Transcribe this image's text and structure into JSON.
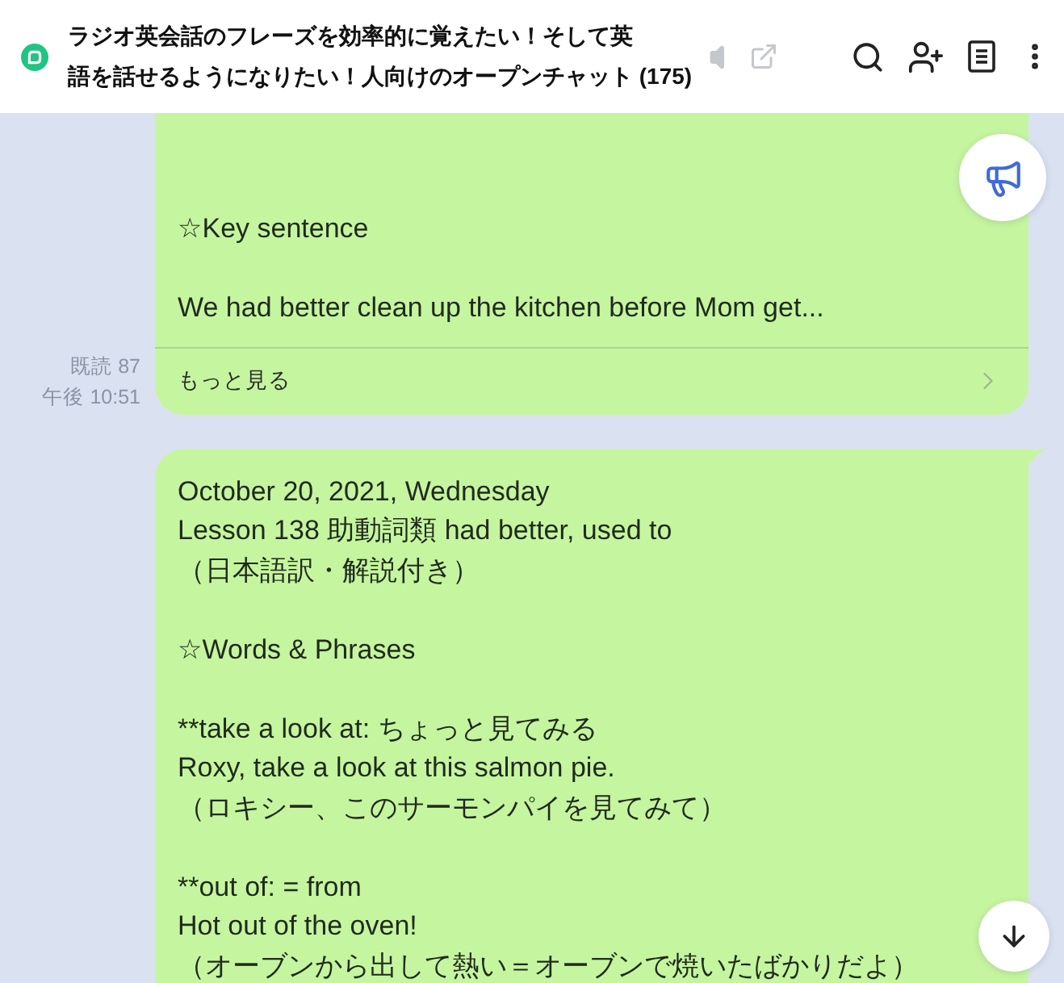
{
  "header": {
    "title_lines": [
      "ラジオ英会話のフレーズを効率的に覚えたい！そして英",
      "語を話せるようになりたい！人向けのオープンチャット (175)"
    ]
  },
  "messages": [
    {
      "read": "既読 87",
      "time": "午後 10:51",
      "paragraphs": [
        [
          "☆Key sentence"
        ],
        [
          "We had better clean up the kitchen before Mom get..."
        ]
      ],
      "more_link": "もっと見る"
    },
    {
      "tail": true,
      "paragraphs": [
        [
          "October 20, 2021, Wednesday",
          "Lesson 138 助動詞類 had better, used to",
          "（日本語訳・解説付き）"
        ],
        [
          "☆Words & Phrases"
        ],
        [
          "**take a look at: ちょっと見てみる",
          "Roxy, take a look at this salmon pie.",
          "（ロキシー、このサーモンパイを見てみて）"
        ],
        [
          "**out of: = from",
          "Hot out of the oven!",
          "（オーブンから出して熱い＝オーブンで焼いたばかりだよ）"
        ]
      ]
    }
  ]
}
